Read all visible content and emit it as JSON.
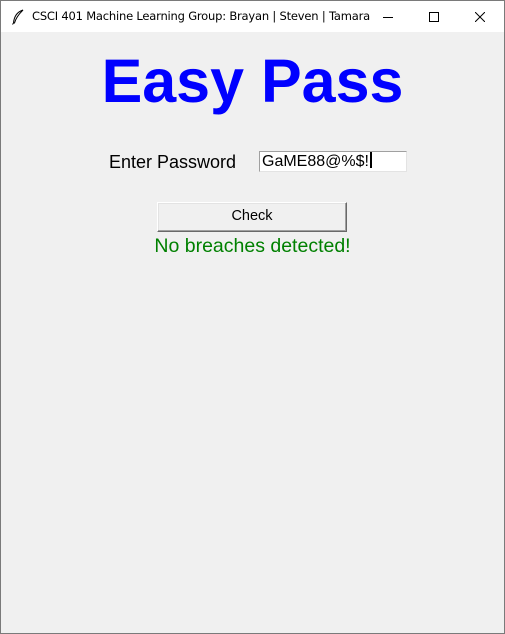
{
  "window": {
    "title": "CSCI 401 Machine Learning Group: Brayan | Steven | Tamara",
    "app_icon": "feather-icon",
    "controls": {
      "minimize_icon": "minimize-icon",
      "maximize_icon": "maximize-icon",
      "close_icon": "close-icon"
    }
  },
  "app": {
    "title": "Easy Pass",
    "password_label": "Enter Password",
    "password_value": "GaME88@%$!",
    "check_button_label": "Check",
    "status_message": "No breaches detected!"
  },
  "colors": {
    "title": "#0000ff",
    "status_ok": "#008000",
    "background": "#f0f0f0"
  }
}
